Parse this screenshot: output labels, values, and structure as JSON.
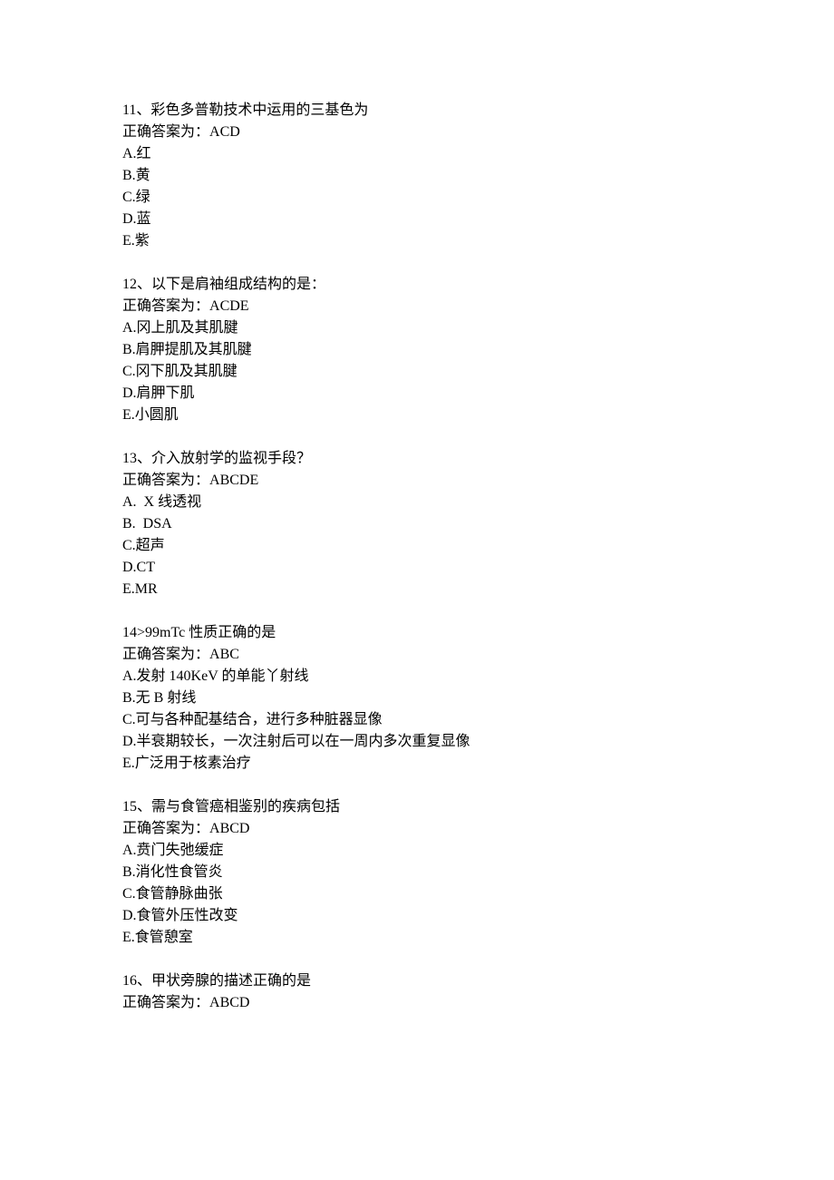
{
  "questions": [
    {
      "num": "11、",
      "stem": "彩色多普勒技术中运用的三基色为",
      "answer_label": "正确答案为：",
      "answer": "ACD",
      "options": [
        "A.红",
        "B.黄",
        "C.绿",
        "D.蓝",
        "E.紫"
      ]
    },
    {
      "num": "12、",
      "stem": "以下是肩袖组成结构的是：",
      "answer_label": "正确答案为：",
      "answer": "ACDE",
      "options": [
        "A.冈上肌及其肌腱",
        "B.肩胛提肌及其肌腱",
        "C.冈下肌及其肌腱",
        "D.肩胛下肌",
        "E.小圆肌"
      ]
    },
    {
      "num": "13、",
      "stem": "介入放射学的监视手段？",
      "answer_label": "正确答案为：",
      "answer": "ABCDE",
      "options": [
        "A.  X 线透视",
        "B.  DSA",
        "C.超声",
        "D.CT",
        "E.MR"
      ]
    },
    {
      "num": "14>",
      "stem": "99mTc 性质正确的是",
      "answer_label": "正确答案为：",
      "answer": "ABC",
      "options": [
        "A.发射 140KeV 的单能丫射线",
        "B.无 B 射线",
        "C.可与各种配基结合，进行多种脏器显像",
        "D.半衰期较长，一次注射后可以在一周内多次重复显像",
        "E.广泛用于核素治疗"
      ]
    },
    {
      "num": "15、",
      "stem": "需与食管癌相鉴别的疾病包括",
      "answer_label": "正确答案为：",
      "answer": "ABCD",
      "options": [
        "A.贲门失弛缓症",
        "B.消化性食管炎",
        "C.食管静脉曲张",
        "D.食管外压性改变",
        "E.食管憩室"
      ]
    },
    {
      "num": "16、",
      "stem": "甲状旁腺的描述正确的是",
      "answer_label": "正确答案为：",
      "answer": "ABCD",
      "options": []
    }
  ]
}
